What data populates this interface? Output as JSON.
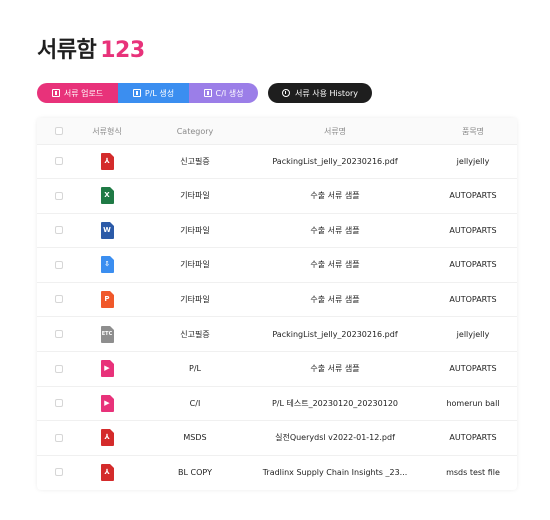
{
  "title": {
    "label": "서류함",
    "count": "123"
  },
  "toolbar": {
    "upload": "서류 업로드",
    "pl": "P/L 생성",
    "ci": "C/I 생성",
    "history": "서류 사용 History"
  },
  "table": {
    "headers": {
      "type": "서류형식",
      "category": "Category",
      "name": "서류명",
      "item": "품목명"
    },
    "rows": [
      {
        "icon": "pdf-icon",
        "glyph": "⅄",
        "color": "#d42b2b",
        "category": "신고필증",
        "name": "PackingList_jelly_20230216.pdf",
        "item": "jellyjelly"
      },
      {
        "icon": "excel-icon",
        "glyph": "X",
        "color": "#1f7a45",
        "category": "기타파일",
        "name": "수출 서류 샘플",
        "item": "AUTOPARTS"
      },
      {
        "icon": "word-icon",
        "glyph": "W",
        "color": "#2b5aa8",
        "category": "기타파일",
        "name": "수출 서류 샘플",
        "item": "AUTOPARTS"
      },
      {
        "icon": "archive-icon",
        "glyph": "⇩",
        "color": "#3b8ef0",
        "category": "기타파일",
        "name": "수출 서류 샘플",
        "item": "AUTOPARTS"
      },
      {
        "icon": "ppt-icon",
        "glyph": "P",
        "color": "#f0582a",
        "category": "기타파일",
        "name": "수출 서류 샘플",
        "item": "AUTOPARTS"
      },
      {
        "icon": "etc-icon",
        "glyph": "ETC",
        "color": "#8e8e8e",
        "category": "신고필증",
        "name": "PackingList_jelly_20230216.pdf",
        "item": "jellyjelly"
      },
      {
        "icon": "tradlinx-icon",
        "glyph": "▶",
        "color": "#e8327a",
        "category": "P/L",
        "name": "수출 서류 샘플",
        "item": "AUTOPARTS"
      },
      {
        "icon": "tradlinx-icon",
        "glyph": "▶",
        "color": "#e8327a",
        "category": "C/I",
        "name": "P/L 테스트_20230120_20230120",
        "item": "homerun ball"
      },
      {
        "icon": "pdf-icon",
        "glyph": "⅄",
        "color": "#d42b2b",
        "category": "MSDS",
        "name": "실전Querydsl v2022-01-12.pdf",
        "item": "AUTOPARTS"
      },
      {
        "icon": "pdf-icon",
        "glyph": "⅄",
        "color": "#d42b2b",
        "category": "BL COPY",
        "name": "Tradlinx Supply Chain Insights _23...",
        "item": "msds test file"
      }
    ]
  },
  "colors": {
    "accent": "#e8327a",
    "pl": "#3b8ef0",
    "ci": "#9b7ee8",
    "dark": "#1e1e1e"
  }
}
